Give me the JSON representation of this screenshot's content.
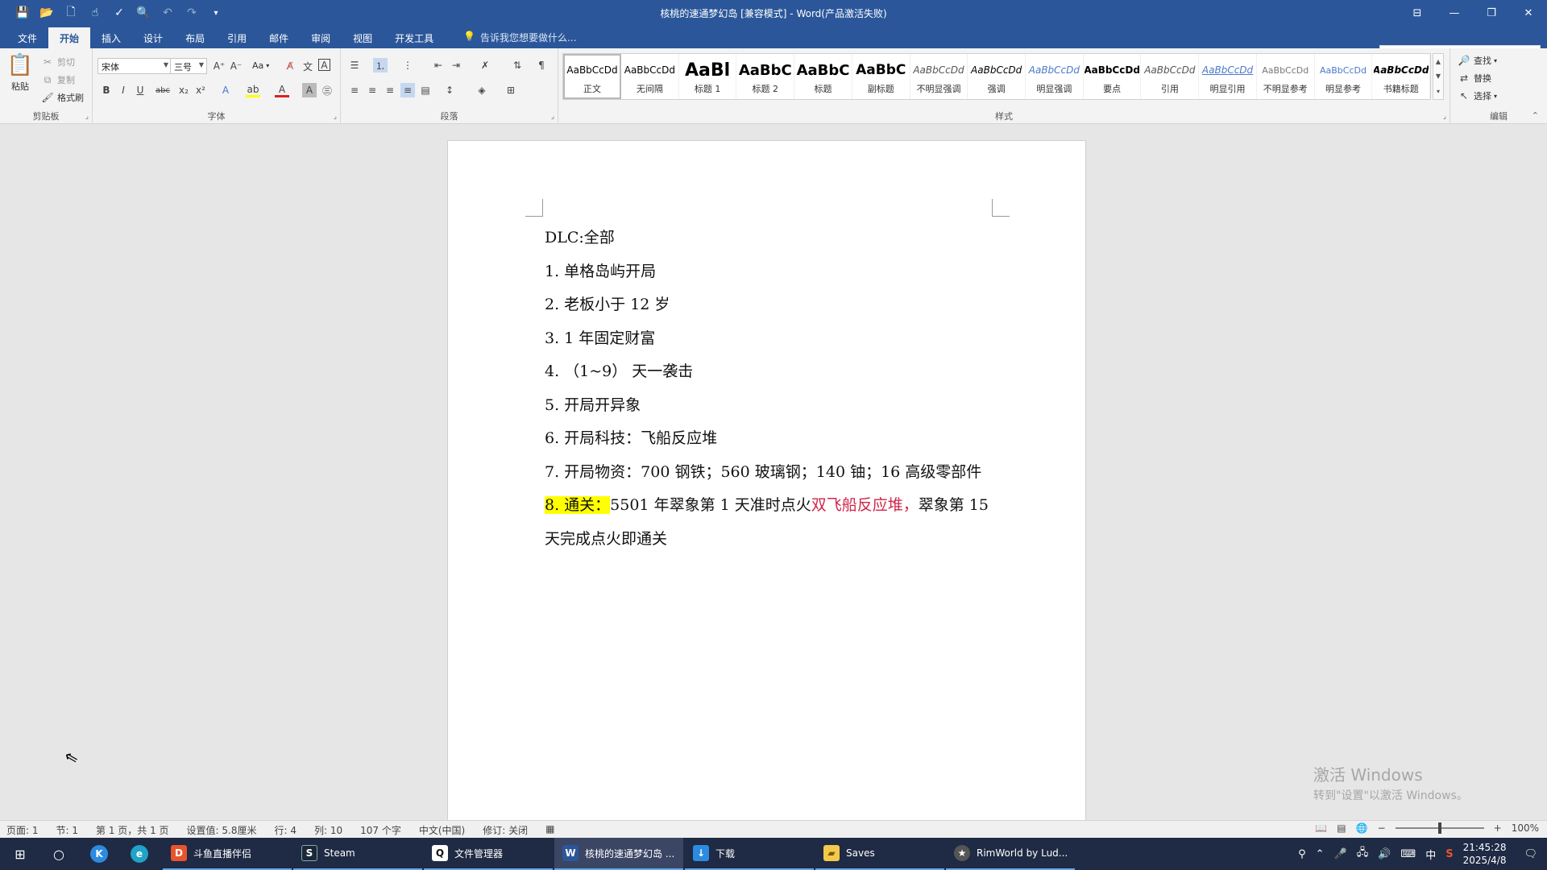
{
  "window": {
    "title": "核桃的速通梦幻岛 [兼容模式] - Word(产品激活失败)"
  },
  "tabs": [
    {
      "label": "文件"
    },
    {
      "label": "开始"
    },
    {
      "label": "插入"
    },
    {
      "label": "设计"
    },
    {
      "label": "布局"
    },
    {
      "label": "引用"
    },
    {
      "label": "邮件"
    },
    {
      "label": "审阅"
    },
    {
      "label": "视图"
    },
    {
      "label": "开发工具"
    }
  ],
  "tell_me": "告诉我您想要做什么...",
  "clipboard": {
    "paste": "粘贴",
    "cut": "剪切",
    "copy": "复制",
    "format_painter": "格式刷",
    "label": "剪贴板"
  },
  "font": {
    "name": "宋体",
    "size": "三号",
    "label": "字体",
    "case_btn": "Aa"
  },
  "paragraph": {
    "label": "段落"
  },
  "styles": {
    "label": "样式",
    "items": [
      {
        "preview": "AaBbCcDd",
        "name": "正文"
      },
      {
        "preview": "AaBbCcDd",
        "name": "无间隔"
      },
      {
        "preview": "AaBl",
        "name": "标题 1"
      },
      {
        "preview": "AaBbC",
        "name": "标题 2"
      },
      {
        "preview": "AaBbC",
        "name": "标题"
      },
      {
        "preview": "AaBbC",
        "name": "副标题"
      },
      {
        "preview": "AaBbCcDd",
        "name": "不明显强调"
      },
      {
        "preview": "AaBbCcDd",
        "name": "强调"
      },
      {
        "preview": "AaBbCcDd",
        "name": "明显强调"
      },
      {
        "preview": "AaBbCcDd",
        "name": "要点"
      },
      {
        "preview": "AaBbCcDd",
        "name": "引用"
      },
      {
        "preview": "AaBbCcDd",
        "name": "明显引用"
      },
      {
        "preview": "AaBbCcDd",
        "name": "不明显参考"
      },
      {
        "preview": "AaBbCcDd",
        "name": "明显参考"
      },
      {
        "preview": "AaBbCcDd",
        "name": "书籍标题"
      }
    ]
  },
  "editing": {
    "label": "编辑",
    "find": "查找",
    "replace": "替换",
    "select": "选择"
  },
  "document": {
    "p0": "DLC:全部",
    "p1": "1. 单格岛屿开局",
    "p2": "2. 老板小于 12 岁",
    "p3": "3. 1 年固定财富",
    "p4": "4. （1~9） 天一袭击",
    "p5": "5. 开局开异象",
    "p6": "6. 开局科技：飞船反应堆",
    "p7": "7. 开局物资：700 钢铁；560 玻璃钢；140 铀；16 高级零部件",
    "p8_hl": "8. 通关：",
    "p8_mid": "5501 年翠象第 1 天准时点火",
    "p8_red": "双飞船反应堆，",
    "p8_end": "翠象第 15 天完成点火即通关"
  },
  "watermark": {
    "line1": "激活 Windows",
    "line2": "转到\"设置\"以激活 Windows。"
  },
  "status": {
    "page": "页面: 1",
    "section": "节: 1",
    "pages": "第 1 页，共 1 页",
    "position": "设置值: 5.8厘米",
    "line": "行: 4",
    "column": "列: 10",
    "words": "107 个字",
    "language": "中文(中国)",
    "track": "修订: 关闭",
    "zoom": "100%",
    "zoom_level": 0.5
  },
  "taskbar": {
    "apps": [
      {
        "label": "斗鱼直播伴侣",
        "icon": "D",
        "color": "#e8542c"
      },
      {
        "label": "Steam",
        "icon": "S",
        "color": "#1b2838"
      },
      {
        "label": "文件管理器",
        "icon": "Q",
        "color": "#111111"
      },
      {
        "label": "核桃的速通梦幻岛 ...",
        "icon": "W",
        "color": "#2b579a"
      },
      {
        "label": "下载",
        "icon": "↓",
        "color": "#2b8be0"
      },
      {
        "label": "Saves",
        "icon": "▰",
        "color": "#f2c94c"
      },
      {
        "label": "RimWorld by Lud...",
        "icon": "★",
        "color": "#555555"
      }
    ],
    "ime": "中",
    "time": "21:45:28",
    "date": "2025/4/8"
  }
}
